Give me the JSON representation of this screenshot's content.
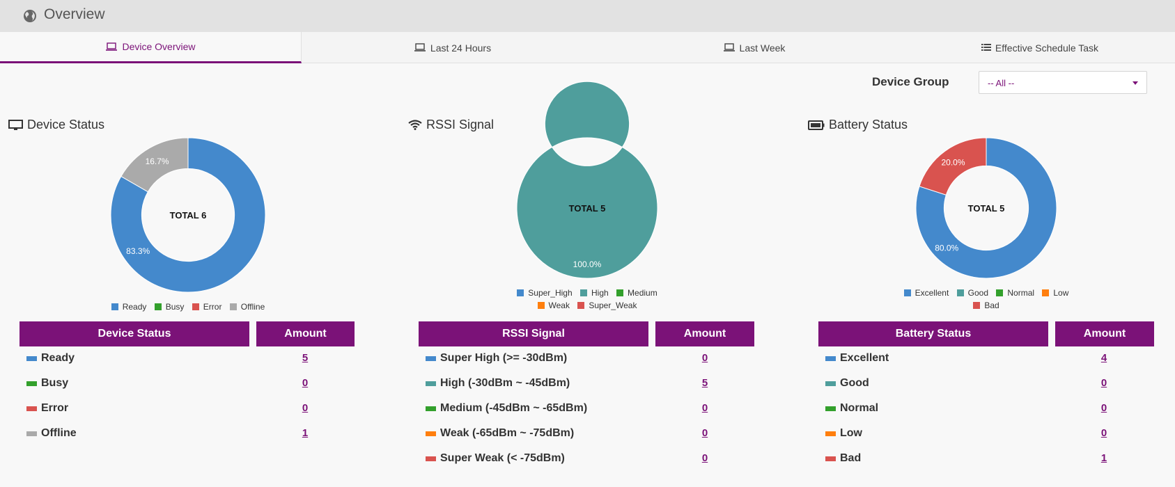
{
  "header": {
    "title": "Overview",
    "icon": "globe-icon"
  },
  "tabs": [
    {
      "label": "Device Overview",
      "icon": "laptop-icon",
      "active": true
    },
    {
      "label": "Last 24 Hours",
      "icon": "laptop-icon",
      "active": false
    },
    {
      "label": "Last Week",
      "icon": "laptop-icon",
      "active": false
    },
    {
      "label": "Effective Schedule Task",
      "icon": "list-icon",
      "active": false
    }
  ],
  "filter": {
    "label": "Device Group",
    "value": "-- All --"
  },
  "colors": {
    "accent": "#7b1278",
    "blue": "#4489cc",
    "teal": "#4f9e9c",
    "green": "#33a02c",
    "orange": "#ff7f0e",
    "red": "#d9534f",
    "gray": "#aaaaaa"
  },
  "panels": {
    "device": {
      "title": "Device Status",
      "icon": "monitor-icon",
      "center_label": "TOTAL 6",
      "slice_labels": [
        "83.3%",
        "16.7%"
      ],
      "legend": [
        "Ready",
        "Busy",
        "Error",
        "Offline"
      ],
      "table_header": "Device Status",
      "amount_header": "Amount",
      "rows": [
        {
          "label": "Ready",
          "amount": "5"
        },
        {
          "label": "Busy",
          "amount": "0"
        },
        {
          "label": "Error",
          "amount": "0"
        },
        {
          "label": "Offline",
          "amount": "1"
        }
      ]
    },
    "rssi": {
      "title": "RSSI Signal",
      "icon": "wifi-icon",
      "center_label": "TOTAL 5",
      "slice_labels": [
        "100.0%"
      ],
      "legend": [
        "Super_High",
        "High",
        "Medium",
        "Weak",
        "Super_Weak"
      ],
      "table_header": "RSSI Signal",
      "amount_header": "Amount",
      "rows": [
        {
          "label": "Super High (>= -30dBm)",
          "amount": "0"
        },
        {
          "label": "High (-30dBm ~ -45dBm)",
          "amount": "5"
        },
        {
          "label": "Medium (-45dBm ~ -65dBm)",
          "amount": "0"
        },
        {
          "label": "Weak (-65dBm ~ -75dBm)",
          "amount": "0"
        },
        {
          "label": "Super Weak (< -75dBm)",
          "amount": "0"
        }
      ]
    },
    "battery": {
      "title": "Battery Status",
      "icon": "battery-icon",
      "center_label": "TOTAL 5",
      "slice_labels": [
        "80.0%",
        "20.0%"
      ],
      "legend": [
        "Excellent",
        "Good",
        "Normal",
        "Low",
        "Bad"
      ],
      "table_header": "Battery Status",
      "amount_header": "Amount",
      "rows": [
        {
          "label": "Excellent",
          "amount": "4"
        },
        {
          "label": "Good",
          "amount": "0"
        },
        {
          "label": "Normal",
          "amount": "0"
        },
        {
          "label": "Low",
          "amount": "0"
        },
        {
          "label": "Bad",
          "amount": "1"
        }
      ]
    }
  },
  "chart_data": [
    {
      "type": "pie",
      "title": "Device Status",
      "categories": [
        "Ready",
        "Busy",
        "Error",
        "Offline"
      ],
      "values": [
        5,
        0,
        0,
        1
      ],
      "colors": [
        "#4489cc",
        "#33a02c",
        "#d9534f",
        "#aaaaaa"
      ]
    },
    {
      "type": "pie",
      "title": "RSSI Signal",
      "categories": [
        "Super_High",
        "High",
        "Medium",
        "Weak",
        "Super_Weak"
      ],
      "values": [
        0,
        5,
        0,
        0,
        0
      ],
      "colors": [
        "#4489cc",
        "#4f9e9c",
        "#33a02c",
        "#ff7f0e",
        "#d9534f"
      ]
    },
    {
      "type": "pie",
      "title": "Battery Status",
      "categories": [
        "Excellent",
        "Good",
        "Normal",
        "Low",
        "Bad"
      ],
      "values": [
        4,
        0,
        0,
        0,
        1
      ],
      "colors": [
        "#4489cc",
        "#4f9e9c",
        "#33a02c",
        "#ff7f0e",
        "#d9534f"
      ]
    }
  ]
}
